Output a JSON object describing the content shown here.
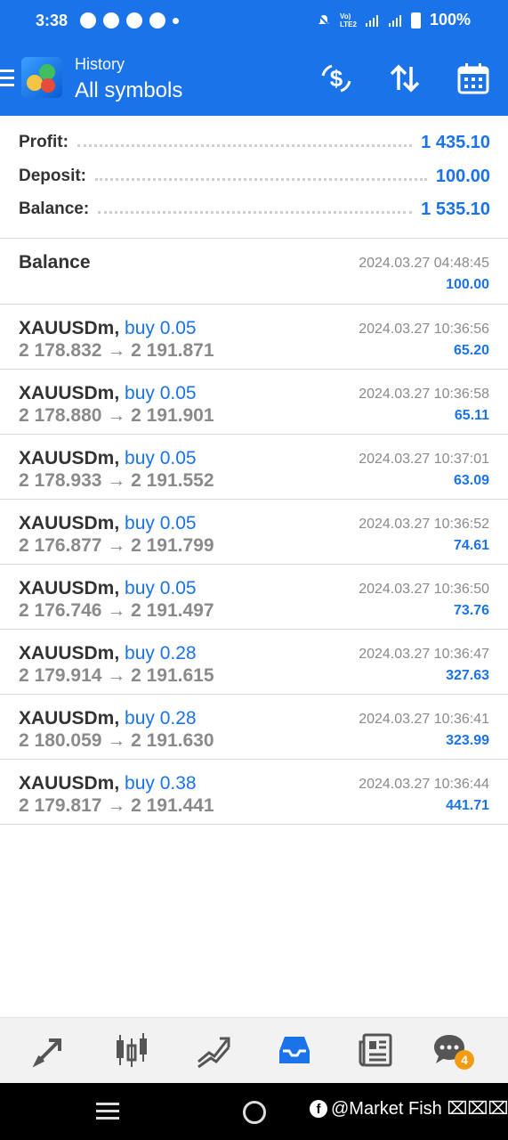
{
  "status": {
    "time": "3:38",
    "battery": "100%",
    "network": "Vo) LTE2"
  },
  "header": {
    "subtitle": "History",
    "title": "All symbols"
  },
  "summary": [
    {
      "label": "Profit:",
      "value": "1 435.10"
    },
    {
      "label": "Deposit:",
      "value": "100.00"
    },
    {
      "label": "Balance:",
      "value": "1 535.10"
    }
  ],
  "balance_entry": {
    "label": "Balance",
    "time": "2024.03.27 04:48:45",
    "amount": "100.00"
  },
  "deals": [
    {
      "symbol": "XAUUSDm,",
      "type": "buy 0.05",
      "prices": "2 178.832 → 2 191.871",
      "time": "2024.03.27 10:36:56",
      "profit": "65.20"
    },
    {
      "symbol": "XAUUSDm,",
      "type": "buy 0.05",
      "prices": "2 178.880 → 2 191.901",
      "time": "2024.03.27 10:36:58",
      "profit": "65.11"
    },
    {
      "symbol": "XAUUSDm,",
      "type": "buy 0.05",
      "prices": "2 178.933 → 2 191.552",
      "time": "2024.03.27 10:37:01",
      "profit": "63.09"
    },
    {
      "symbol": "XAUUSDm,",
      "type": "buy 0.05",
      "prices": "2 176.877 → 2 191.799",
      "time": "2024.03.27 10:36:52",
      "profit": "74.61"
    },
    {
      "symbol": "XAUUSDm,",
      "type": "buy 0.05",
      "prices": "2 176.746 → 2 191.497",
      "time": "2024.03.27 10:36:50",
      "profit": "73.76"
    },
    {
      "symbol": "XAUUSDm,",
      "type": "buy 0.28",
      "prices": "2 179.914 → 2 191.615",
      "time": "2024.03.27 10:36:47",
      "profit": "327.63"
    },
    {
      "symbol": "XAUUSDm,",
      "type": "buy 0.28",
      "prices": "2 180.059 → 2 191.630",
      "time": "2024.03.27 10:36:41",
      "profit": "323.99"
    },
    {
      "symbol": "XAUUSDm,",
      "type": "buy 0.38",
      "prices": "2 179.817 → 2 191.441",
      "time": "2024.03.27 10:36:44",
      "profit": "441.71"
    }
  ],
  "nav": {
    "chat_badge": "4"
  },
  "watermark": {
    "text": "@Market Fish ⌧⌧⌧"
  },
  "colors": {
    "accent": "#1a73e8",
    "header_bg": "#1a73e8",
    "badge": "#f39c12"
  }
}
